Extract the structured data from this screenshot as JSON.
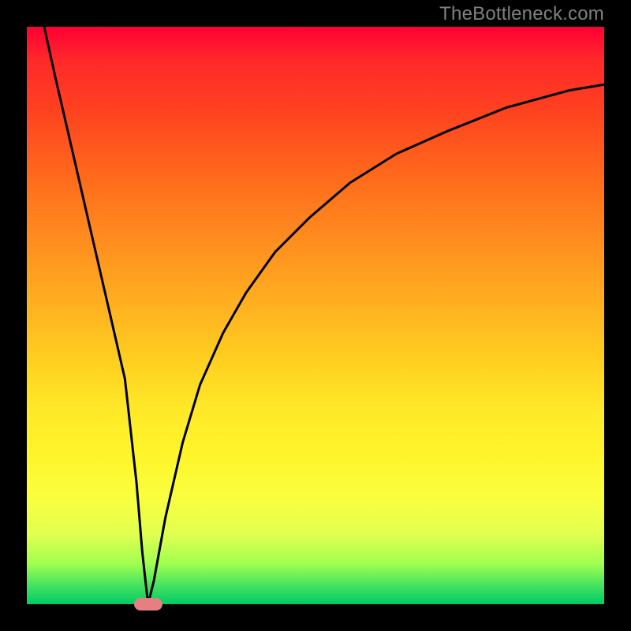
{
  "watermark": "TheBottleneck.com",
  "colors": {
    "border": "#000000",
    "gradient_top": "#ff0033",
    "gradient_bottom": "#00cc66",
    "curve": "#000000",
    "marker": "#e58080",
    "watermark_text": "#808080"
  },
  "chart_data": {
    "type": "line",
    "title": "",
    "xlabel": "",
    "ylabel": "",
    "xlim": [
      0,
      100
    ],
    "ylim": [
      0,
      100
    ],
    "grid": false,
    "legend": false,
    "series": [
      {
        "name": "curve",
        "x": [
          3,
          5,
          8,
          11,
          14,
          17,
          19,
          20,
          21,
          22,
          24,
          27,
          30,
          34,
          38,
          43,
          49,
          56,
          64,
          73,
          83,
          94,
          100
        ],
        "values": [
          100,
          91,
          78,
          65,
          52,
          39,
          21,
          9,
          0,
          4,
          15,
          28,
          38,
          47,
          54,
          61,
          67,
          73,
          78,
          82,
          86,
          89,
          90
        ]
      }
    ],
    "marker": {
      "x": 21,
      "y": 0
    }
  }
}
